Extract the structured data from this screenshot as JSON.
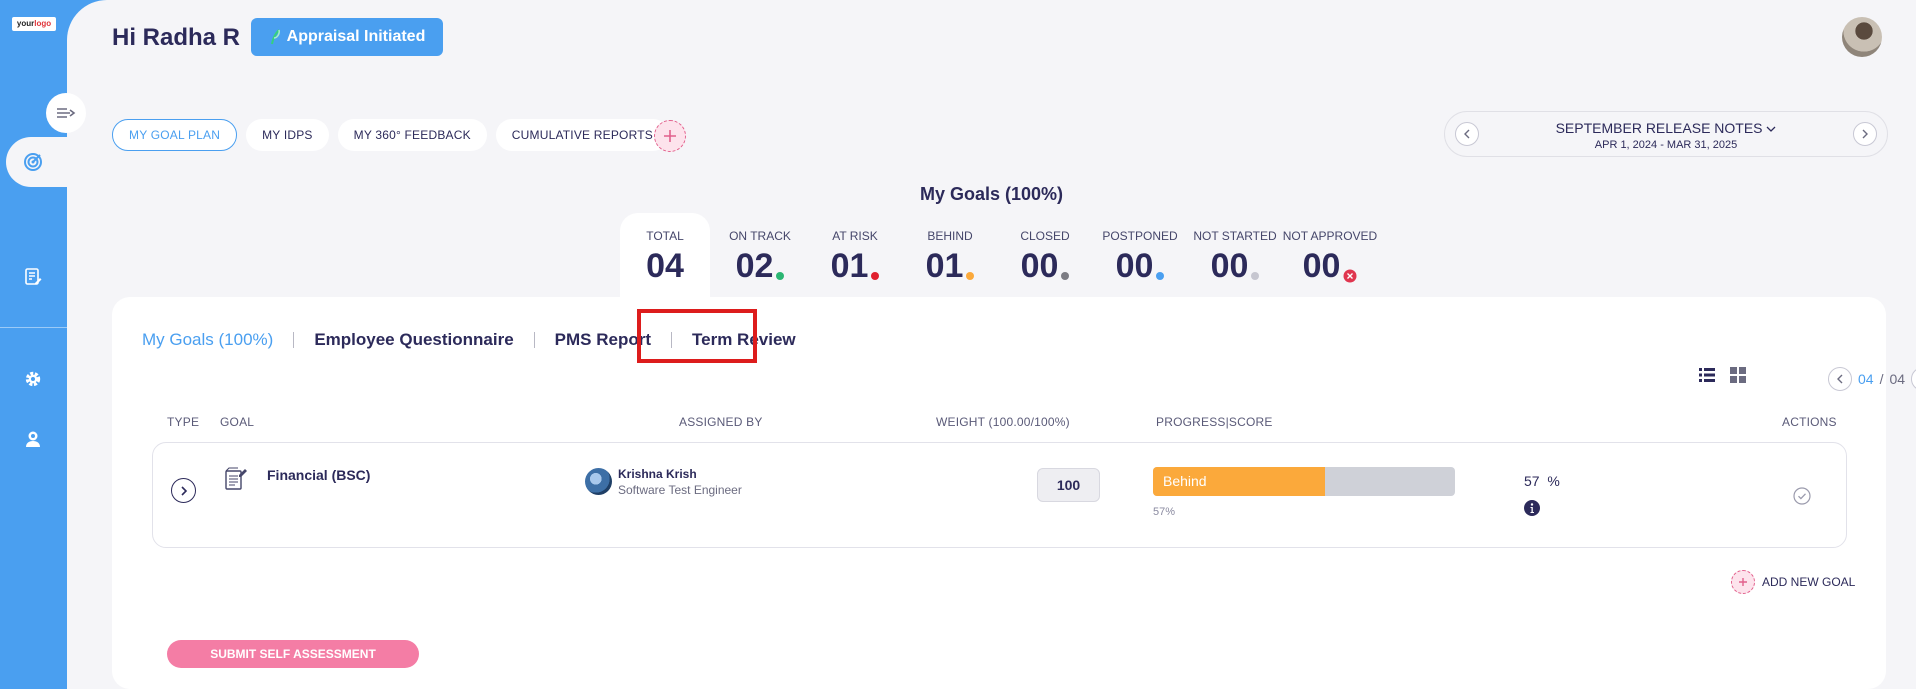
{
  "logo": {
    "text_main": "your",
    "text_accent": "logo"
  },
  "header": {
    "greeting": "Hi Radha R",
    "appraisal_button": "Appraisal Initiated"
  },
  "top_tabs": [
    "MY GOAL PLAN",
    "MY IDPS",
    "MY 360° FEEDBACK",
    "CUMULATIVE REPORTS"
  ],
  "release": {
    "title": "SEPTEMBER RELEASE NOTES",
    "dates": "APR 1, 2024 - MAR 31, 2025"
  },
  "goals_heading": "My Goals (100%)",
  "stats": [
    {
      "label": "TOTAL",
      "value": "04"
    },
    {
      "label": "ON TRACK",
      "value": "02",
      "color": "#2bb673"
    },
    {
      "label": "AT RISK",
      "value": "01",
      "color": "#e0202e"
    },
    {
      "label": "BEHIND",
      "value": "01",
      "color": "#fba93b"
    },
    {
      "label": "CLOSED",
      "value": "00",
      "color": "#7c7c84"
    },
    {
      "label": "POSTPONED",
      "value": "00",
      "color": "#4a9ff0"
    },
    {
      "label": "NOT STARTED",
      "value": "00",
      "color": "#c6c6d0"
    },
    {
      "label": "NOT APPROVED",
      "value": "00",
      "color": "#e0354f"
    }
  ],
  "sub_tabs": [
    "My Goals (100%)",
    "Employee Questionnaire",
    "PMS Report",
    "Term Review"
  ],
  "pager": {
    "current": "04",
    "separator": "/",
    "total": "04"
  },
  "columns": {
    "type": "TYPE",
    "goal": "GOAL",
    "assigned_by": "ASSIGNED BY",
    "weight": "WEIGHT (100.00/100%)",
    "progress": "PROGRESS|SCORE",
    "actions": "ACTIONS"
  },
  "goal_row": {
    "name": "Financial (BSC)",
    "assignee_name": "Krishna Krish",
    "assignee_role": "Software Test Engineer",
    "weight": "100",
    "status": "Behind",
    "progress": 0.57,
    "progress_label": "57%",
    "score": "57",
    "score_unit": "%"
  },
  "add_goal_label": "ADD NEW GOAL",
  "submit_label": "SUBMIT SELF ASSESSMENT"
}
